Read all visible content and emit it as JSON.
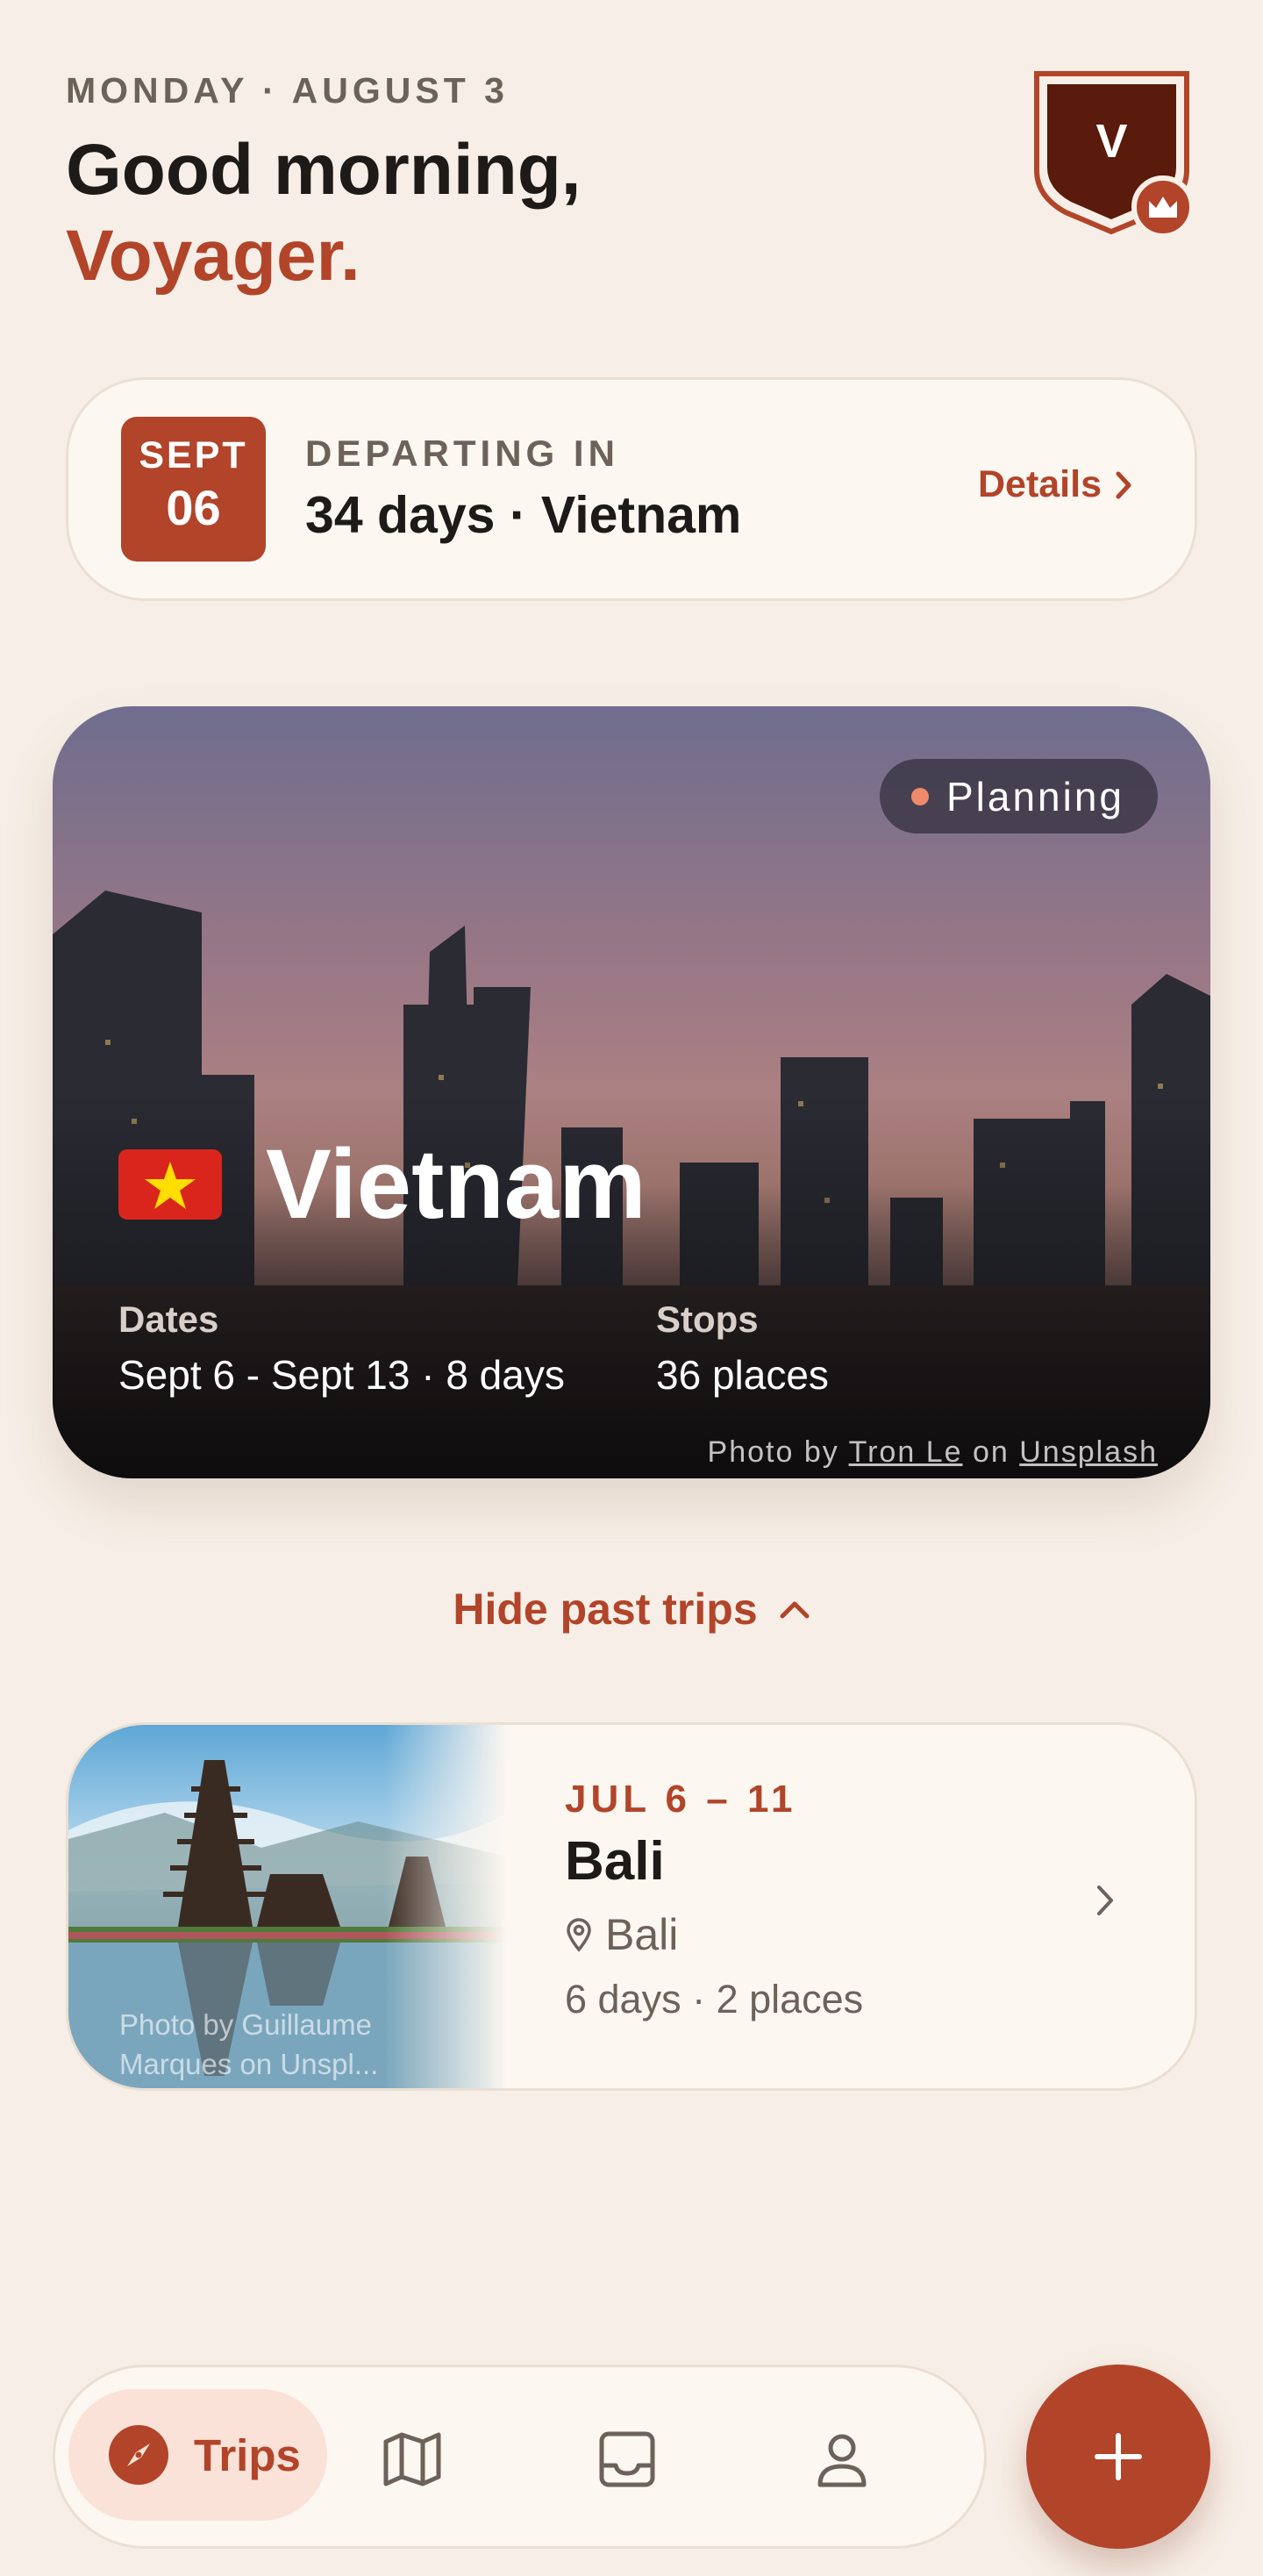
{
  "header": {
    "date": "MONDAY · AUGUST 3",
    "greeting": "Good morning,",
    "name": "Voyager.",
    "avatar_letter": "V"
  },
  "countdown": {
    "month": "SEPT",
    "day": "06",
    "label": "DEPARTING IN",
    "value": "34 days · Vietnam",
    "details": "Details"
  },
  "featured_trip": {
    "status": "Planning",
    "flag": "🇻🇳",
    "title": "Vietnam",
    "dates_label": "Dates",
    "dates_value": "Sept 6 - Sept 13 · 8 days",
    "stops_label": "Stops",
    "stops_value": "36 places",
    "credit_prefix": "Photo by",
    "credit_author": "Tron Le",
    "credit_on": "on",
    "credit_site": "Unsplash"
  },
  "past_toggle": "Hide past trips",
  "past_trips": [
    {
      "dates": "JUL 6 – 11",
      "title": "Bali",
      "location": "Bali",
      "meta": "6 days · 2 places",
      "credit": "Photo by Guillaume Marques on Unspl..."
    }
  ],
  "nav": {
    "trips_label": "Trips",
    "icons": [
      "compass-icon",
      "map-icon",
      "inbox-icon",
      "person-icon",
      "plus-icon"
    ]
  },
  "colors": {
    "accent": "#b2442a",
    "background": "#f7efe7",
    "avatar": "#5a1a0c"
  }
}
